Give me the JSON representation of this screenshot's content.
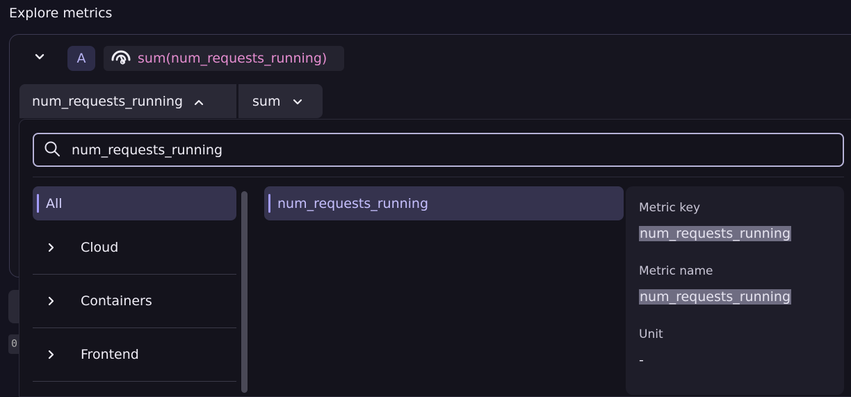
{
  "page": {
    "title": "Explore metrics"
  },
  "query": {
    "letter": "A",
    "expression": "sum(num_requests_running)",
    "metric": "num_requests_running",
    "aggregation": "sum"
  },
  "search": {
    "value": "num_requests_running"
  },
  "categories": [
    {
      "label": "All",
      "selected": true
    },
    {
      "label": "Cloud"
    },
    {
      "label": "Containers"
    },
    {
      "label": "Frontend"
    }
  ],
  "metrics": [
    {
      "label": "num_requests_running",
      "selected": true
    }
  ],
  "details": {
    "metric_key_label": "Metric key",
    "metric_key_value": "num_requests_running",
    "metric_name_label": "Metric name",
    "metric_name_value": "num_requests_running",
    "unit_label": "Unit",
    "unit_value": "-"
  },
  "hidden": {
    "partial_text": "0"
  },
  "colors": {
    "accent": "#a39cff",
    "expression": "#e58dd0",
    "background": "#14131f"
  }
}
